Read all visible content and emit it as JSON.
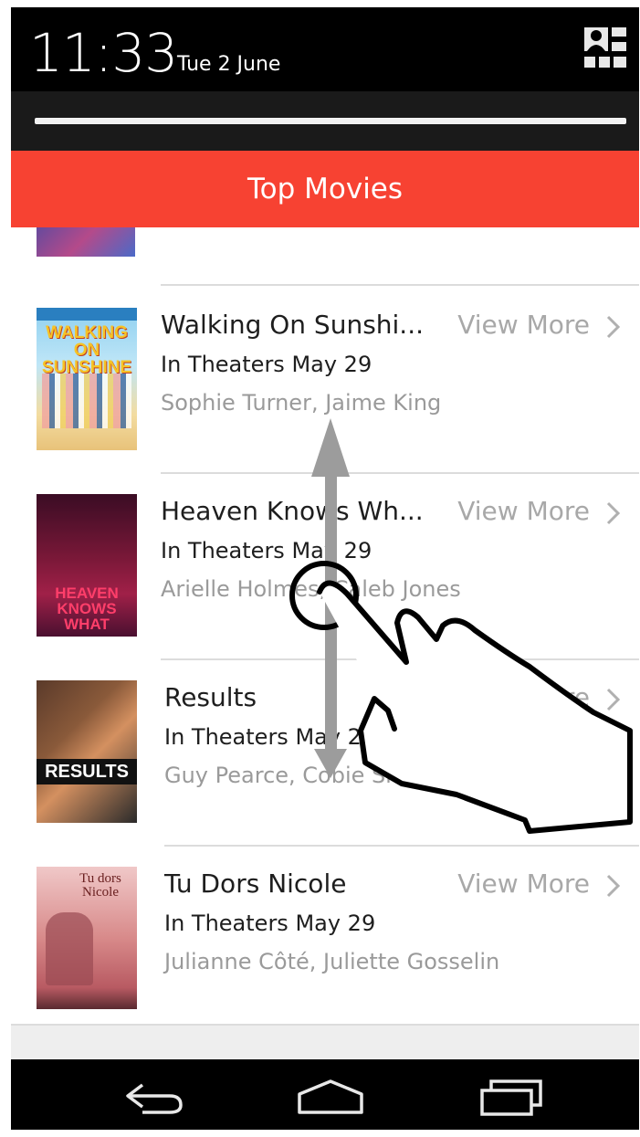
{
  "status_bar": {
    "time": "11:33",
    "date": "Tue 2 June",
    "user_icon": "user-profile-icon"
  },
  "header": {
    "title": "Top Movies",
    "color": "#f74232"
  },
  "movies": [
    {
      "title": "Walking On Sunshi...",
      "release": "In Theaters May 29",
      "cast": "Sophie Turner, Jaime King",
      "action": "View More",
      "poster_text": "WALKING ON SUNSHINE"
    },
    {
      "title": "Heaven Knows Wh...",
      "release": "In Theaters May 29",
      "cast": "Arielle Holmes, Caleb Jones",
      "action": "View More",
      "poster_text": "HEAVEN KNOWS WHAT"
    },
    {
      "title": "Results",
      "release": "In Theaters May 29",
      "cast": "Guy Pearce, Cobie Smulders",
      "action": "View More",
      "poster_text": "RESULTS"
    },
    {
      "title": "Tu Dors Nicole",
      "release": "In Theaters May 29",
      "cast": "Julianne Côté, Juliette Gosselin",
      "action": "View More",
      "poster_text": "Tu dors Nicole"
    }
  ],
  "navbar": {
    "back_icon": "back-icon",
    "home_icon": "home-icon",
    "recents_icon": "recents-icon"
  },
  "gesture": {
    "type": "swipe-up-down",
    "icon": "hand-swipe-icon"
  }
}
